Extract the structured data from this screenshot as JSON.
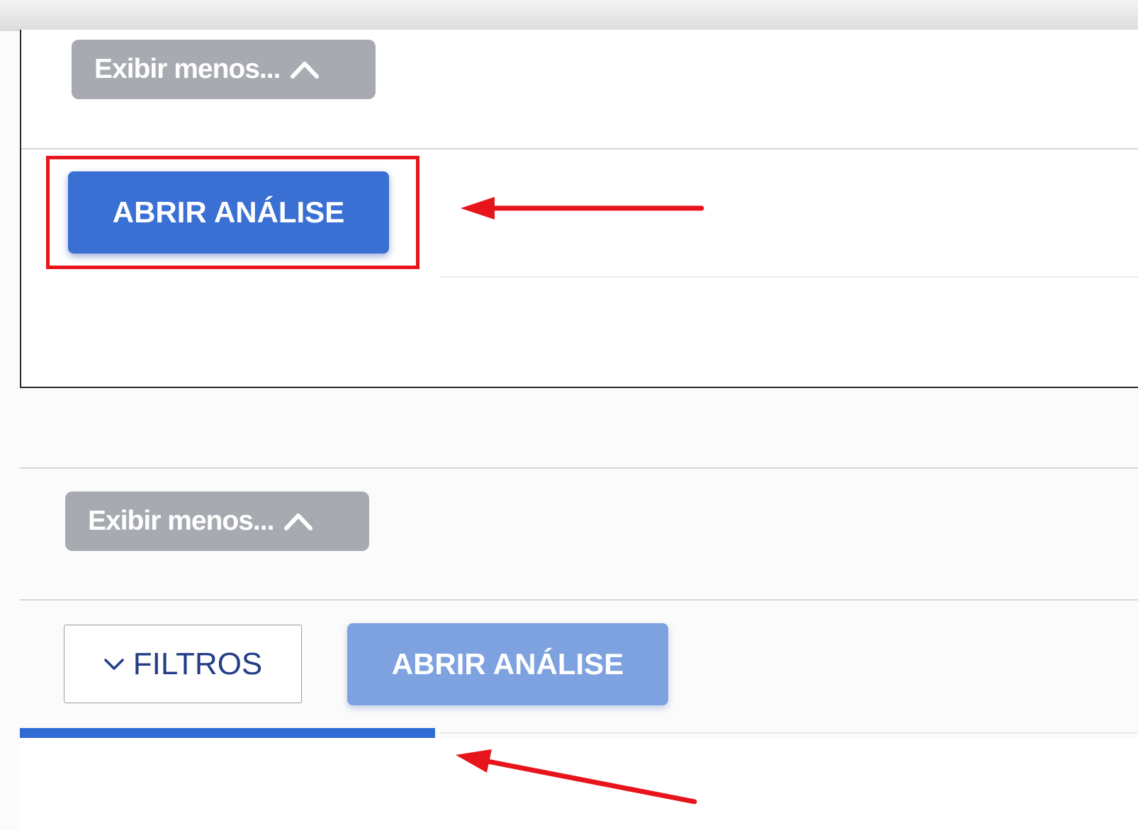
{
  "panel_top": {
    "show_less_label": "Exibir menos...",
    "open_analysis_label": "ABRIR ANÁLISE"
  },
  "panel_bottom": {
    "show_less_label": "Exibir menos...",
    "filters_label": "FILTROS",
    "open_analysis_label": "ABRIR ANÁLISE"
  },
  "colors": {
    "primary_button": "#3a6fd4",
    "primary_button_disabled": "#7ea1e0",
    "secondary_button": "#a7aab1",
    "annotation_red": "#e8141c"
  },
  "icons": {
    "show_less": "chevron-up-icon",
    "filters": "chevron-down-icon"
  }
}
